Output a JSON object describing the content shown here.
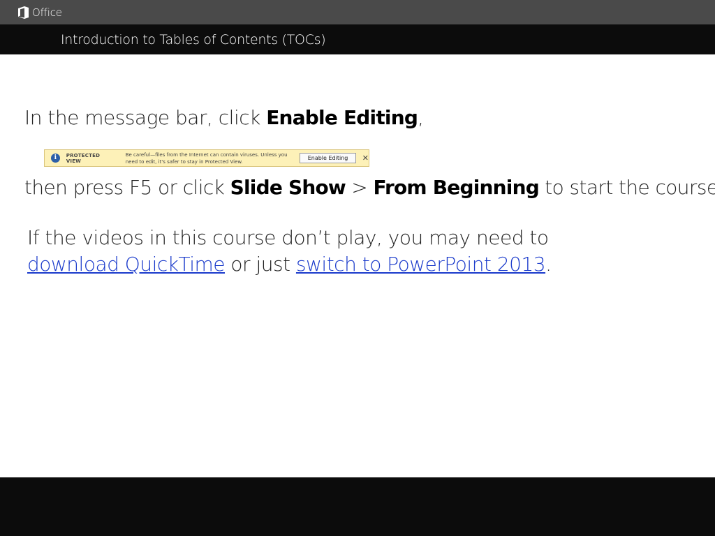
{
  "app": {
    "name": "Office"
  },
  "course": {
    "title": "Introduction to Tables of Contents (TOCs)"
  },
  "instructions": {
    "line1_prefix": "In the message bar, click ",
    "line1_bold": "Enable Editing",
    "line1_suffix": ",",
    "line2_prefix": "then press F5 or click ",
    "line2_bold1": "Slide Show",
    "line2_sep": " > ",
    "line2_bold2": "From Beginning",
    "line2_suffix": " to start the course."
  },
  "message_bar": {
    "label": "PROTECTED VIEW",
    "text": "Be careful—files from the Internet can contain viruses. Unless you need to edit, it's safer to stay in Protected View.",
    "button_label": "Enable Editing",
    "close_glyph": "✕"
  },
  "note": {
    "line1": "If the videos in this course don’t play, you may need to",
    "link1": "download QuickTime",
    "middle": " or just ",
    "link2": "switch to PowerPoint 2013",
    "end": "."
  },
  "colors": {
    "topbar": "#4a4a4a",
    "titlebar": "#0c0c0c",
    "link": "#1a3acb",
    "message_bar_bg": "#fdf1b8"
  }
}
